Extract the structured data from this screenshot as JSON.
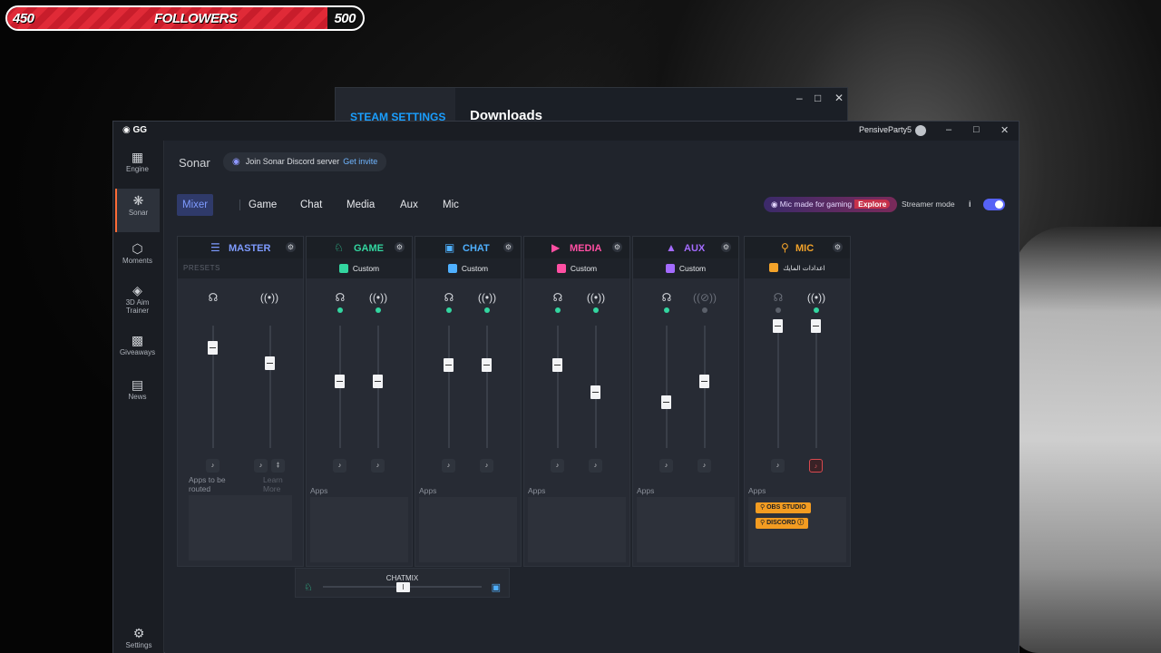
{
  "followers": {
    "current": "450",
    "label": "FOLLOWERS",
    "goal": "500",
    "progress": 0.9
  },
  "steam": {
    "section": "STEAM SETTINGS",
    "page": "Downloads"
  },
  "app": {
    "logo": "GG",
    "user": "PensiveParty5",
    "nav": [
      {
        "label": "Engine"
      },
      {
        "label": "Sonar"
      },
      {
        "label": "Moments"
      },
      {
        "label": "3D Aim Trainer"
      },
      {
        "label": "Giveaways"
      },
      {
        "label": "News"
      }
    ],
    "settings_label": "Settings",
    "title": "Sonar",
    "discord": {
      "text": "Join Sonar Discord server",
      "link": "Get invite"
    },
    "tabs": [
      "Mixer",
      "Game",
      "Chat",
      "Media",
      "Aux",
      "Mic"
    ],
    "promo": {
      "text": "Mic made for gaming",
      "link": "Explore"
    },
    "streamer_mode": {
      "label": "Streamer mode",
      "info": "i",
      "enabled": true
    }
  },
  "channels": [
    {
      "name": "MASTER",
      "color": "#7e9bff",
      "preset": "PRESETS",
      "apps_label": "Apps to be routed",
      "learn_more": "Learn More",
      "levels": [
        0.82,
        0.7
      ]
    },
    {
      "name": "GAME",
      "color": "#33d6a0",
      "preset": "Custom",
      "apps_label": "Apps",
      "levels": [
        0.55,
        0.55
      ]
    },
    {
      "name": "CHAT",
      "color": "#4fb0ff",
      "preset": "Custom",
      "apps_label": "Apps",
      "levels": [
        0.68,
        0.68
      ]
    },
    {
      "name": "MEDIA",
      "color": "#ff4fa3",
      "preset": "Custom",
      "apps_label": "Apps",
      "levels": [
        0.68,
        0.46
      ]
    },
    {
      "name": "AUX",
      "color": "#a46bff",
      "preset": "Custom",
      "apps_label": "Apps",
      "levels": [
        0.38,
        0.55
      ]
    },
    {
      "name": "MIC",
      "color": "#f3a32a",
      "preset": "اعدادات المايك",
      "apps_label": "Apps",
      "levels": [
        1.0,
        1.0
      ],
      "apps": [
        "OBS STUDIO",
        "DISCORD"
      ]
    }
  ],
  "chatmix": {
    "label": "CHATMIX",
    "knob": "I"
  }
}
